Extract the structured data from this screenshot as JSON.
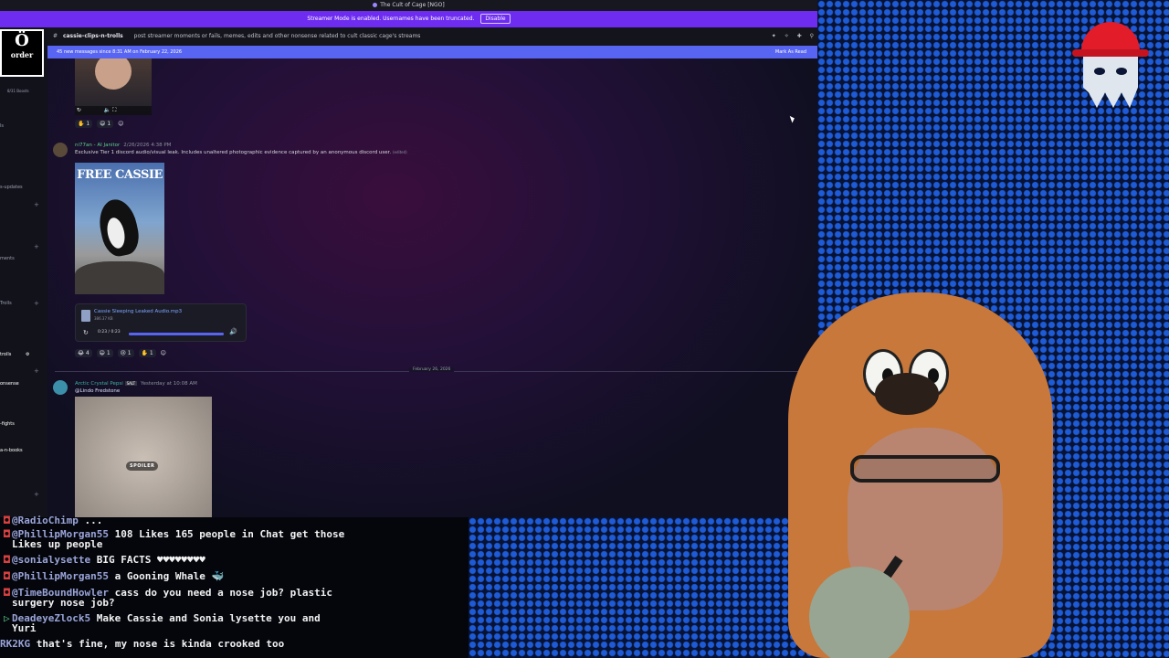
{
  "window": {
    "title": "The Cult of Cage [NGO]"
  },
  "streamer_bar": {
    "text": "Streamer Mode is enabled. Usernames have been truncated.",
    "disable_label": "Disable"
  },
  "server_logo": {
    "line1": "Ö",
    "line2": "order"
  },
  "server_rail": {
    "boosts": "8/31 Boosts",
    "items": [
      "ls",
      "s-updates",
      "ments",
      "Trolls",
      "trolls",
      "onsense",
      "-fights",
      "a-n-books"
    ]
  },
  "channel": {
    "name": "cassie-clips-n-trolls",
    "topic": "post streamer moments or fails, memes, edits and other nonsense related to cult classic cage's streams"
  },
  "new_messages": {
    "text": "45 new messages since 8:31 AM on February 22, 2026",
    "mark_read": "Mark As Read"
  },
  "reactions_top": [
    "1",
    "1"
  ],
  "message1": {
    "author": "ni77an - AI Janitor",
    "timestamp": "2/26/2026 4:38 PM",
    "body": "Exclusive Tier 1 discord audio/visual leak. Includes unaltered photographic evidence captured by an anonymous discord user.",
    "edited": "(edited)",
    "poster_title": "FREE CASSIE",
    "audio": {
      "filename": "Cassie Sleeping Leaked Audio.mp3",
      "size": "386.37 KB",
      "time": "0:23 / 0:23",
      "progress": 1.0
    },
    "reactions": [
      "4",
      "1",
      "1",
      "1"
    ]
  },
  "date_divider": "February 26, 2026",
  "message2": {
    "author": "Arctic Crystal Pepsi",
    "badge": "SALT",
    "timestamp": "Yesterday at 10:08 AM",
    "body": "@Lindo Fredstone",
    "spoiler_label": "SPOILER"
  },
  "stream_chat": [
    {
      "user": "@RadioChimp",
      "text": " ..."
    },
    {
      "user": "@PhillipMorgan55",
      "text": " 108 Likes 165 people in Chat get those"
    },
    {
      "user": "",
      "text": "Likes up people"
    },
    {
      "user": "@sonialysette",
      "text": " BIG FACTS ♥♥♥♥♥♥♥♥"
    },
    {
      "user": "@PhillipMorgan55",
      "text": " a Gooning Whale 🐳"
    },
    {
      "user": "@TimeBoundHowler",
      "text": " cass do you need a nose job? plastic"
    },
    {
      "user": "",
      "text": "surgery nose job?"
    },
    {
      "user": "DeadeyeZlock5",
      "text": " Make Cassie and Sonia lysette you and"
    },
    {
      "user": "",
      "text": "Yuri"
    },
    {
      "user": "RK2KG",
      "text": " that's fine, my nose is kinda crooked too"
    }
  ],
  "colors": {
    "streamer_bar": "#6e2cf0",
    "new_messages": "#5865f2",
    "author_green": "#5fd18c",
    "hood": "#c8783a",
    "logo_cap": "#e31c2a"
  }
}
